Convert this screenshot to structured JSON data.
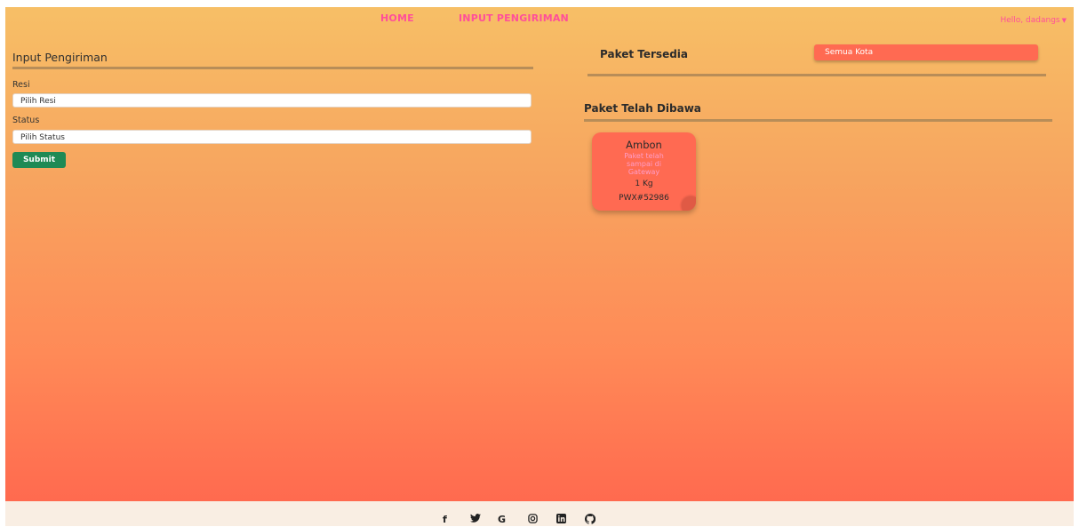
{
  "nav": {
    "home": "HOME",
    "input_pengiriman": "INPUT PENGIRIMAN",
    "user_greeting": "Hello, dadangs"
  },
  "form": {
    "title": "Input Pengiriman",
    "resi_label": "Resi",
    "resi_value": "Pilih Resi",
    "status_label": "Status",
    "status_value": "Pilih Status",
    "submit_label": "Submit"
  },
  "paket_tersedia": {
    "title": "Paket Tersedia",
    "city_filter": "Semua Kota"
  },
  "paket_dibawa": {
    "title": "Paket Telah Dibawa",
    "cards": [
      {
        "city": "Ambon",
        "status": "Paket telah sampai di Gateway",
        "weight": "1 Kg",
        "resi": "PWX#52986"
      }
    ]
  },
  "footer": {
    "icons": [
      "facebook-icon",
      "twitter-icon",
      "google-icon",
      "instagram-icon",
      "linkedin-icon",
      "github-icon"
    ]
  },
  "colors": {
    "nav_link": "#ff4f9a",
    "submit": "#1f8a55",
    "card": "#ff6a52"
  }
}
